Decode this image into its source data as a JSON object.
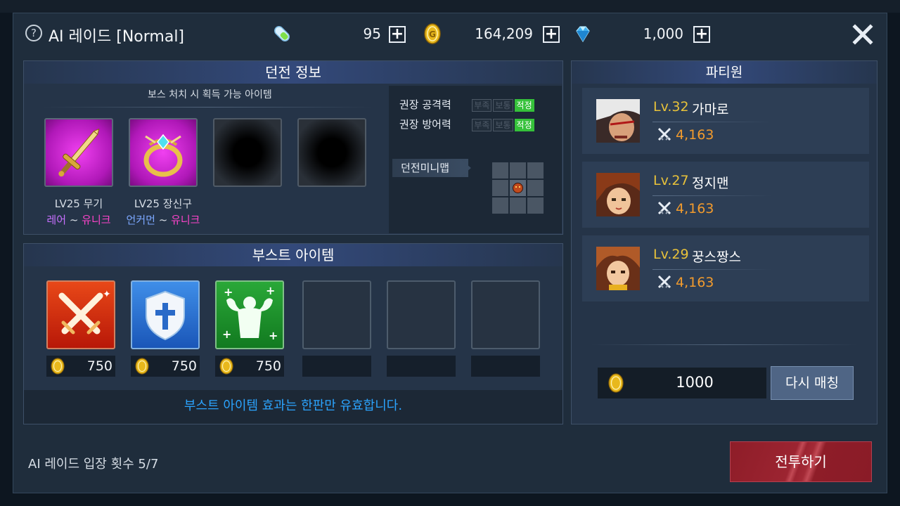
{
  "header": {
    "help_symbol": "?",
    "title": "AI 레이드 [Normal]",
    "resources": [
      {
        "icon": "energy-capsule-icon",
        "value": "95"
      },
      {
        "icon": "gold-coin-icon",
        "value": "164,209"
      },
      {
        "icon": "diamond-gem-icon",
        "value": "1,000"
      }
    ],
    "plus_symbol": "+"
  },
  "dungeon": {
    "title": "던전 정보",
    "loot_label": "보스 처치 시 획득 가능 아이템",
    "items": [
      {
        "level": "LV25 무기",
        "rarity_from": "레어",
        "sep": "~",
        "rarity_to": "유니크",
        "icon": "sword-icon"
      },
      {
        "level": "LV25 장신구",
        "rarity_from": "언커먼",
        "sep": "~",
        "rarity_to": "유니크",
        "icon": "ring-icon"
      }
    ],
    "stats": [
      {
        "label": "권장 공격력",
        "tags": [
          "부족",
          "보통",
          "적정"
        ],
        "active": "적정"
      },
      {
        "label": "권장 방어력",
        "tags": [
          "부족",
          "보통",
          "적정"
        ],
        "active": "적정"
      }
    ],
    "minimap_label": "던전미니맵"
  },
  "boost": {
    "title": "부스트 아이템",
    "items": [
      {
        "icon": "crossed-swords-icon",
        "price": "750"
      },
      {
        "icon": "shield-cross-icon",
        "price": "750"
      },
      {
        "icon": "muscle-plus-icon",
        "price": "750"
      }
    ],
    "note": "부스트 아이템 효과는 한판만 유효합니다."
  },
  "party": {
    "title": "파티원",
    "members": [
      {
        "level": "Lv.32",
        "name": "가마로",
        "power": "4,163"
      },
      {
        "level": "Lv.27",
        "name": "정지맨",
        "power": "4,163"
      },
      {
        "level": "Lv.29",
        "name": "꿍스짱스",
        "power": "4,163"
      }
    ],
    "rematch_cost": "1000",
    "rematch_label": "다시 매칭"
  },
  "footer": {
    "entry_count": "AI 레이드 입장 횟수 5/7",
    "battle_label": "전투하기"
  },
  "colors": {
    "accent_gold": "#e8c23a",
    "power_orange": "#f29b2d",
    "note_blue": "#2ba4ff",
    "battle_red": "#9c2431",
    "tag_green": "#35c13a"
  }
}
